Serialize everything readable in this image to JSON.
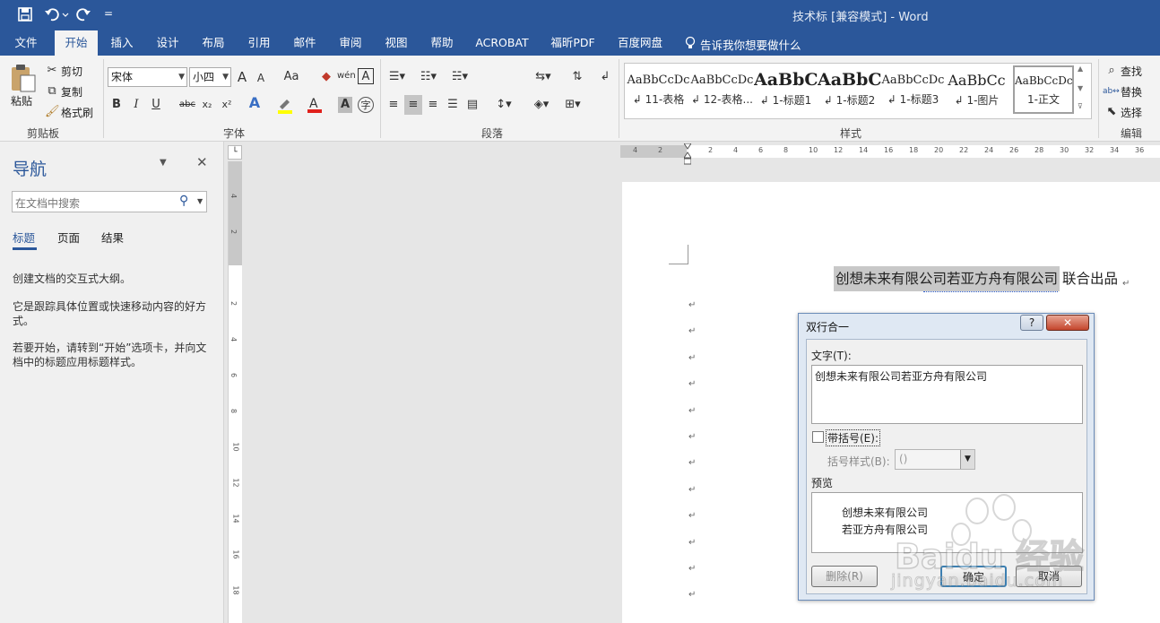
{
  "titlebar": {
    "title": "技术标 [兼容模式]  -  Word",
    "qat_more": "="
  },
  "tabs": [
    "文件",
    "开始",
    "插入",
    "设计",
    "布局",
    "引用",
    "邮件",
    "审阅",
    "视图",
    "帮助",
    "ACROBAT",
    "福昕PDF",
    "百度网盘"
  ],
  "tell_me": "告诉我你想要做什么",
  "ribbon": {
    "clipboard": {
      "paste": "粘贴",
      "cut": "剪切",
      "copy": "复制",
      "format_painter": "格式刷",
      "label": "剪贴板"
    },
    "font": {
      "font_name": "宋体",
      "font_size": "小四",
      "label": "字体",
      "bold": "B",
      "italic": "I",
      "underline": "U",
      "strike": "abc",
      "sub": "x₂",
      "sup": "x²",
      "case": "Aa",
      "grow": "A",
      "shrink": "A",
      "phonetic": "wén",
      "box": "A"
    },
    "paragraph": {
      "label": "段落"
    },
    "styles": {
      "label": "样式",
      "items": [
        {
          "preview": "AaBbCcDc",
          "name": "↲ 11-表格"
        },
        {
          "preview": "AaBbCcDc",
          "name": "↲ 12-表格..."
        },
        {
          "preview": "AaBbC",
          "name": "↲ 1-标题1"
        },
        {
          "preview": "AaBbC",
          "name": "↲ 1-标题2"
        },
        {
          "preview": "AaBbCcDc",
          "name": "↲ 1-标题3"
        },
        {
          "preview": "AaBbCc",
          "name": "↲ 1-图片"
        },
        {
          "preview": "AaBbCcDc",
          "name": "1-正文"
        }
      ]
    },
    "editing": {
      "find": "查找",
      "replace": "替换",
      "select": "选择",
      "label": "编辑"
    }
  },
  "nav": {
    "title": "导航",
    "search_placeholder": "在文档中搜索",
    "tabs": [
      "标题",
      "页面",
      "结果"
    ],
    "text1": "创建文档的交互式大纲。",
    "text2": "它是跟踪具体位置或快速移动内容的好方式。",
    "text3": "若要开始，请转到“开始”选项卡，并向文档中的标题应用标题样式。"
  },
  "hruler": [
    "4",
    "2",
    "",
    "2",
    "4",
    "6",
    "8",
    "10",
    "12",
    "14",
    "16",
    "18",
    "20",
    "22",
    "24",
    "26",
    "28",
    "30",
    "32",
    "34",
    "36"
  ],
  "vruler": [
    "4",
    "2",
    "",
    "2",
    "4",
    "6",
    "8",
    "10",
    "12",
    "14",
    "16",
    "18"
  ],
  "document": {
    "line1": "创想未来有限公司若亚方舟有限公司",
    "line1_tail": "联合出品",
    "para_mark": "↵"
  },
  "dialog": {
    "title": "双行合一",
    "help": "?",
    "close": "✕",
    "text_label": "文字(T):",
    "text_value": "创想未来有限公司若亚方舟有限公司",
    "bracket_checkbox": "带括号(E):",
    "bracket_style_label": "括号样式(B):",
    "bracket_style_value": "()",
    "preview_label": "预览",
    "preview_line1": "创想未来有限公司",
    "preview_line2": "若亚方舟有限公司",
    "delete": "删除(R)",
    "ok": "确定",
    "cancel": "取消"
  },
  "watermark": {
    "brand": "Baidu 经验",
    "url": "jingyan.baidu.com"
  }
}
